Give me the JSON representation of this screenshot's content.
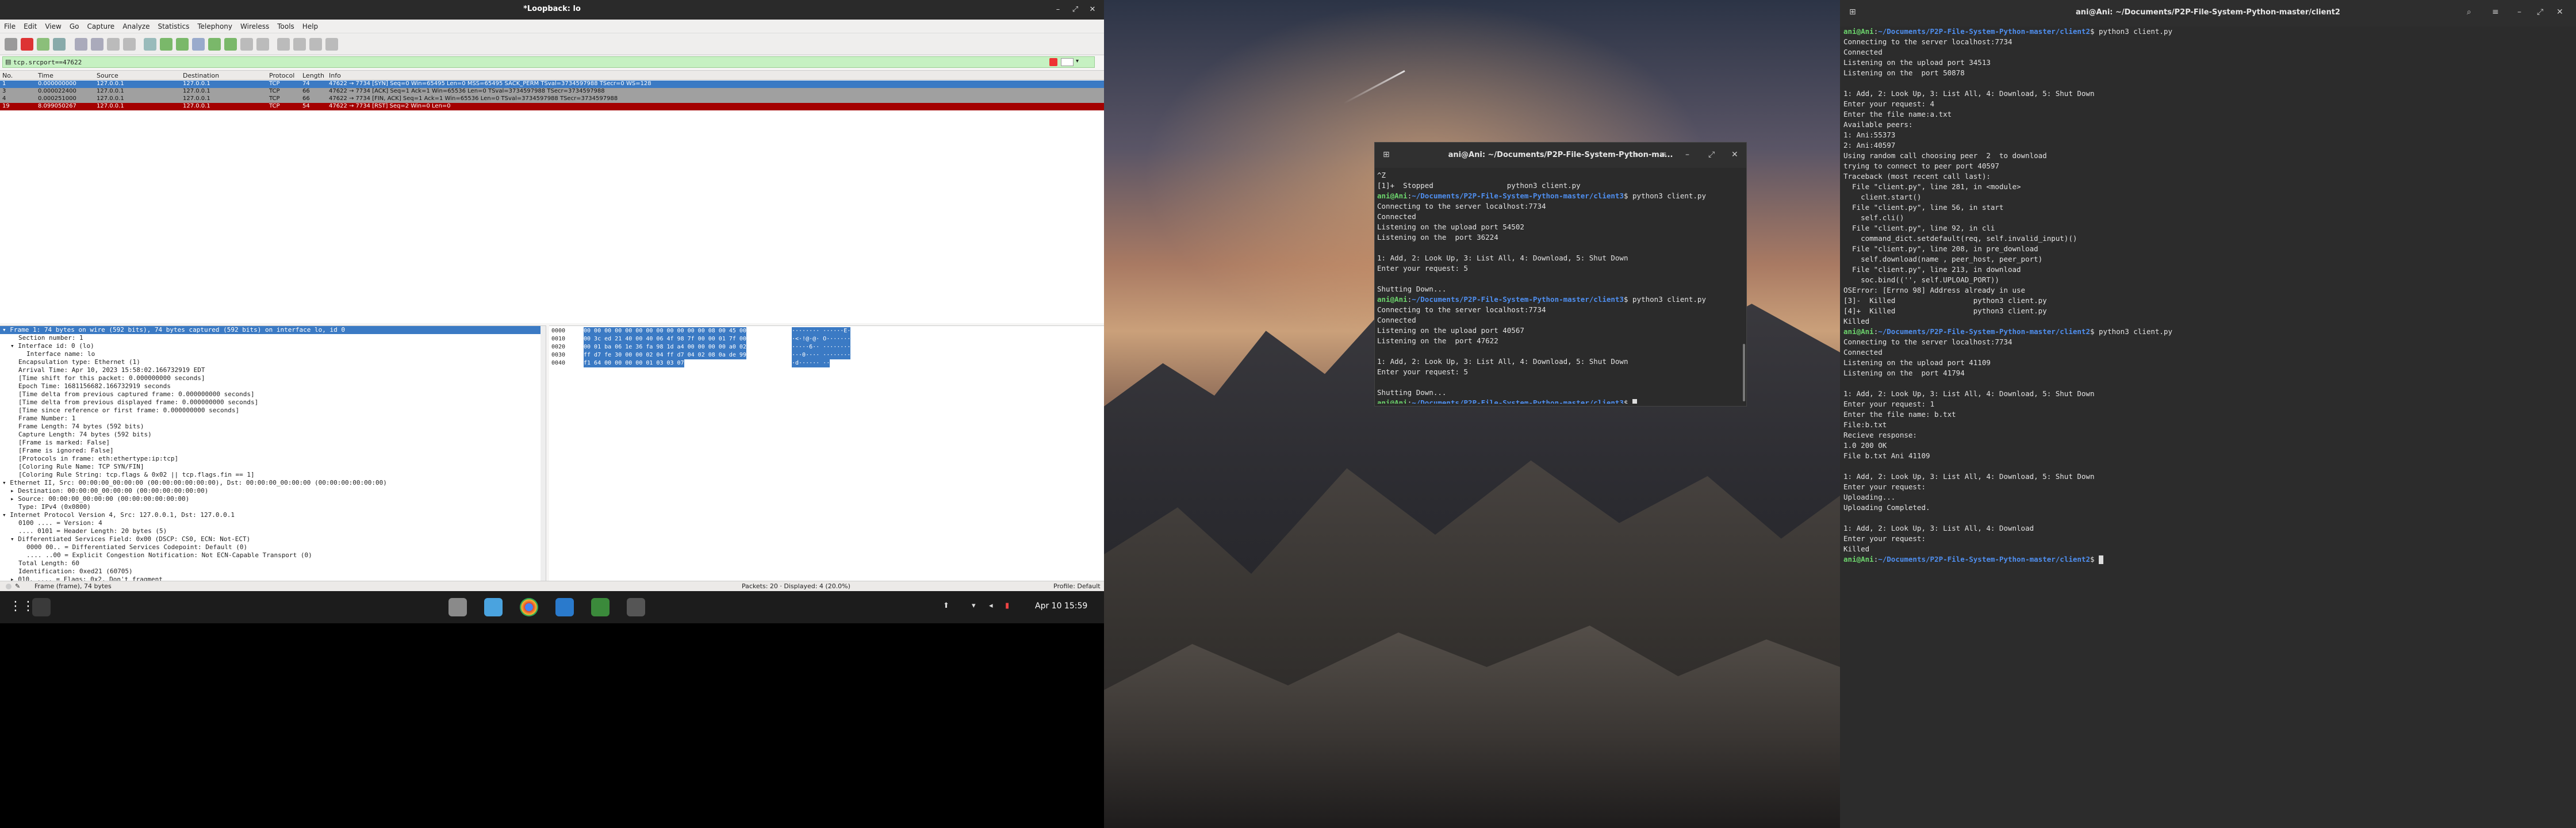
{
  "wireshark": {
    "title": "*Loopback: lo",
    "menu": [
      "File",
      "Edit",
      "View",
      "Go",
      "Capture",
      "Analyze",
      "Statistics",
      "Telephony",
      "Wireless",
      "Tools",
      "Help"
    ],
    "filter": "tcp.srcport==47622",
    "columns": [
      "No.",
      "Time",
      "Source",
      "Destination",
      "Protocol",
      "Length",
      "Info"
    ],
    "packets": [
      {
        "no": "1",
        "time": "0.000000000",
        "src": "127.0.0.1",
        "dst": "127.0.0.1",
        "proto": "TCP",
        "len": "74",
        "info": "47622 → 7734 [SYN] Seq=0 Win=65495 Len=0 MSS=65495 SACK_PERM TSval=3734597988 TSecr=0 WS=128",
        "style": "sel"
      },
      {
        "no": "3",
        "time": "0.000022400",
        "src": "127.0.0.1",
        "dst": "127.0.0.1",
        "proto": "TCP",
        "len": "66",
        "info": "47622 → 7734 [ACK] Seq=1 Ack=1 Win=65536 Len=0 TSval=3734597988 TSecr=3734597988",
        "style": "plain"
      },
      {
        "no": "4",
        "time": "0.000251000",
        "src": "127.0.0.1",
        "dst": "127.0.0.1",
        "proto": "TCP",
        "len": "66",
        "info": "47622 → 7734 [FIN, ACK] Seq=1 Ack=1 Win=65536 Len=0 TSval=3734597988 TSecr=3734597988",
        "style": "plain"
      },
      {
        "no": "19",
        "time": "8.099050267",
        "src": "127.0.0.1",
        "dst": "127.0.0.1",
        "proto": "TCP",
        "len": "54",
        "info": "47622 → 7734 [RST] Seq=2 Win=0 Len=0",
        "style": "rst"
      }
    ],
    "detail": [
      {
        "t": "▾ Frame 1: 74 bytes on wire (592 bits), 74 bytes captured (592 bits) on interface lo, id 0",
        "i": 0,
        "sel": true
      },
      {
        "t": "Section number: 1",
        "i": 2
      },
      {
        "t": "▾ Interface id: 0 (lo)",
        "i": 1
      },
      {
        "t": "Interface name: lo",
        "i": 3
      },
      {
        "t": "Encapsulation type: Ethernet (1)",
        "i": 2
      },
      {
        "t": "Arrival Time: Apr 10, 2023 15:58:02.166732919 EDT",
        "i": 2
      },
      {
        "t": "[Time shift for this packet: 0.000000000 seconds]",
        "i": 2
      },
      {
        "t": "Epoch Time: 1681156682.166732919 seconds",
        "i": 2
      },
      {
        "t": "[Time delta from previous captured frame: 0.000000000 seconds]",
        "i": 2
      },
      {
        "t": "[Time delta from previous displayed frame: 0.000000000 seconds]",
        "i": 2
      },
      {
        "t": "[Time since reference or first frame: 0.000000000 seconds]",
        "i": 2
      },
      {
        "t": "Frame Number: 1",
        "i": 2
      },
      {
        "t": "Frame Length: 74 bytes (592 bits)",
        "i": 2
      },
      {
        "t": "Capture Length: 74 bytes (592 bits)",
        "i": 2
      },
      {
        "t": "[Frame is marked: False]",
        "i": 2
      },
      {
        "t": "[Frame is ignored: False]",
        "i": 2
      },
      {
        "t": "[Protocols in frame: eth:ethertype:ip:tcp]",
        "i": 2
      },
      {
        "t": "[Coloring Rule Name: TCP SYN/FIN]",
        "i": 2
      },
      {
        "t": "[Coloring Rule String: tcp.flags & 0x02 || tcp.flags.fin == 1]",
        "i": 2
      },
      {
        "t": "▾ Ethernet II, Src: 00:00:00_00:00:00 (00:00:00:00:00:00), Dst: 00:00:00_00:00:00 (00:00:00:00:00:00)",
        "i": 0
      },
      {
        "t": "▸ Destination: 00:00:00_00:00:00 (00:00:00:00:00:00)",
        "i": 1
      },
      {
        "t": "▸ Source: 00:00:00_00:00:00 (00:00:00:00:00:00)",
        "i": 1
      },
      {
        "t": "Type: IPv4 (0x0800)",
        "i": 2
      },
      {
        "t": "▾ Internet Protocol Version 4, Src: 127.0.0.1, Dst: 127.0.0.1",
        "i": 0
      },
      {
        "t": "0100 .... = Version: 4",
        "i": 2
      },
      {
        "t": ".... 0101 = Header Length: 20 bytes (5)",
        "i": 2
      },
      {
        "t": "▾ Differentiated Services Field: 0x00 (DSCP: CS0, ECN: Not-ECT)",
        "i": 1
      },
      {
        "t": "0000 00.. = Differentiated Services Codepoint: Default (0)",
        "i": 3
      },
      {
        "t": ".... ..00 = Explicit Congestion Notification: Not ECN-Capable Transport (0)",
        "i": 3
      },
      {
        "t": "Total Length: 60",
        "i": 2
      },
      {
        "t": "Identification: 0xed21 (60705)",
        "i": 2
      },
      {
        "t": "▸ 010. .... = Flags: 0x2, Don't fragment",
        "i": 1
      }
    ],
    "hex": [
      {
        "off": "0000",
        "bytes": "00 00 00 00 00 00 00 00  00 00 00 00 08 00 45 00",
        "ascii": "········ ······E·"
      },
      {
        "off": "0010",
        "bytes": "00 3c ed 21 40 00 40 06  4f 98 7f 00 00 01 7f 00",
        "ascii": "·<·!@·@· O·······"
      },
      {
        "off": "0020",
        "bytes": "00 01 ba 06 1e 36 fa 98  1d a4 00 00 00 00 a0 02",
        "ascii": "·····6·· ········"
      },
      {
        "off": "0030",
        "bytes": "ff d7 fe 30 00 00 02 04  ff d7 04 02 08 0a de 99",
        "ascii": "···0···· ········"
      },
      {
        "off": "0040",
        "bytes": "f1 64 00 00 00 00 01 03  03 07",
        "ascii": "·d······ ··"
      }
    ],
    "status_left": "Frame (frame), 74 bytes",
    "status_mid": "Packets: 20 · Displayed: 4 (20.0%)",
    "status_right": "Profile: Default"
  },
  "taskbar": {
    "clock": "Apr 10  15:59"
  },
  "terminal1": {
    "title": "ani@Ani: ~/Documents/P2P-File-System-Python-ma...",
    "lines": [
      {
        "t": "^Z"
      },
      {
        "t": "[1]+  Stopped                 python3 client.py"
      },
      {
        "u": "ani@Ani",
        "p": "~/Documents/P2P-File-System-Python-master/client3",
        "c": "$ python3 client.py"
      },
      {
        "t": "Connecting to the server localhost:7734"
      },
      {
        "t": "Connected"
      },
      {
        "t": "Listening on the upload port 54502"
      },
      {
        "t": "Listening on the  port 36224"
      },
      {
        "t": ""
      },
      {
        "t": "1: Add, 2: Look Up, 3: List All, 4: Download, 5: Shut Down"
      },
      {
        "t": "Enter your request: 5"
      },
      {
        "t": ""
      },
      {
        "t": "Shutting Down..."
      },
      {
        "u": "ani@Ani",
        "p": "~/Documents/P2P-File-System-Python-master/client3",
        "c": "$ python3 client.py"
      },
      {
        "t": "Connecting to the server localhost:7734"
      },
      {
        "t": "Connected"
      },
      {
        "t": "Listening on the upload port 40567"
      },
      {
        "t": "Listening on the  port 47622"
      },
      {
        "t": ""
      },
      {
        "t": "1: Add, 2: Look Up, 3: List All, 4: Download, 5: Shut Down"
      },
      {
        "t": "Enter your request: 5"
      },
      {
        "t": ""
      },
      {
        "t": "Shutting Down..."
      },
      {
        "u": "ani@Ani",
        "p": "~/Documents/P2P-File-System-Python-master/client3",
        "c": "$ "
      }
    ]
  },
  "terminal2": {
    "title": "ani@Ani: ~/Documents/P2P-File-System-Python-master/client2",
    "lines": [
      {
        "u": "ani@Ani",
        "p": "~/Documents/P2P-File-System-Python-master/client2",
        "c": "$ python3 client.py"
      },
      {
        "t": "Connecting to the server localhost:7734"
      },
      {
        "t": "Connected"
      },
      {
        "t": "Listening on the upload port 34513"
      },
      {
        "t": "Listening on the  port 50878"
      },
      {
        "t": ""
      },
      {
        "t": "1: Add, 2: Look Up, 3: List All, 4: Download, 5: Shut Down"
      },
      {
        "t": "Enter your request: 4"
      },
      {
        "t": "Enter the file name:a.txt"
      },
      {
        "t": "Available peers:"
      },
      {
        "t": "1: Ani:55373"
      },
      {
        "t": "2: Ani:40597"
      },
      {
        "t": "Using random call choosing peer  2  to download"
      },
      {
        "t": "trying to connect to peer port 40597"
      },
      {
        "t": "Traceback (most recent call last):"
      },
      {
        "t": "  File \"client.py\", line 281, in <module>"
      },
      {
        "t": "    client.start()"
      },
      {
        "t": "  File \"client.py\", line 56, in start"
      },
      {
        "t": "    self.cli()"
      },
      {
        "t": "  File \"client.py\", line 92, in cli"
      },
      {
        "t": "    command_dict.setdefault(req, self.invalid_input)()"
      },
      {
        "t": "  File \"client.py\", line 208, in pre_download"
      },
      {
        "t": "    self.download(name , peer_host, peer_port)"
      },
      {
        "t": "  File \"client.py\", line 213, in download"
      },
      {
        "t": "    soc.bind(('', self.UPLOAD_PORT))"
      },
      {
        "t": "OSError: [Errno 98] Address already in use"
      },
      {
        "t": "[3]-  Killed                  python3 client.py"
      },
      {
        "t": "[4]+  Killed                  python3 client.py"
      },
      {
        "t": "Killed"
      },
      {
        "u": "ani@Ani",
        "p": "~/Documents/P2P-File-System-Python-master/client2",
        "c": "$ python3 client.py"
      },
      {
        "t": "Connecting to the server localhost:7734"
      },
      {
        "t": "Connected"
      },
      {
        "t": "Listening on the upload port 41109"
      },
      {
        "t": "Listening on the  port 41794"
      },
      {
        "t": ""
      },
      {
        "t": "1: Add, 2: Look Up, 3: List All, 4: Download, 5: Shut Down"
      },
      {
        "t": "Enter your request: 1"
      },
      {
        "t": "Enter the file name: b.txt"
      },
      {
        "t": "File:b.txt"
      },
      {
        "t": "Recieve response:"
      },
      {
        "t": "1.0 200 OK"
      },
      {
        "t": "File b.txt Ani 41109"
      },
      {
        "t": ""
      },
      {
        "t": "1: Add, 2: Look Up, 3: List All, 4: Download, 5: Shut Down"
      },
      {
        "t": "Enter your request:"
      },
      {
        "t": "Uploading..."
      },
      {
        "t": "Uploading Completed."
      },
      {
        "t": ""
      },
      {
        "t": "1: Add, 2: Look Up, 3: List All, 4: Download"
      },
      {
        "t": "Enter your request:"
      },
      {
        "t": "Killed"
      },
      {
        "u": "ani@Ani",
        "p": "~/Documents/P2P-File-System-Python-master/client2",
        "c": "$ "
      }
    ]
  }
}
